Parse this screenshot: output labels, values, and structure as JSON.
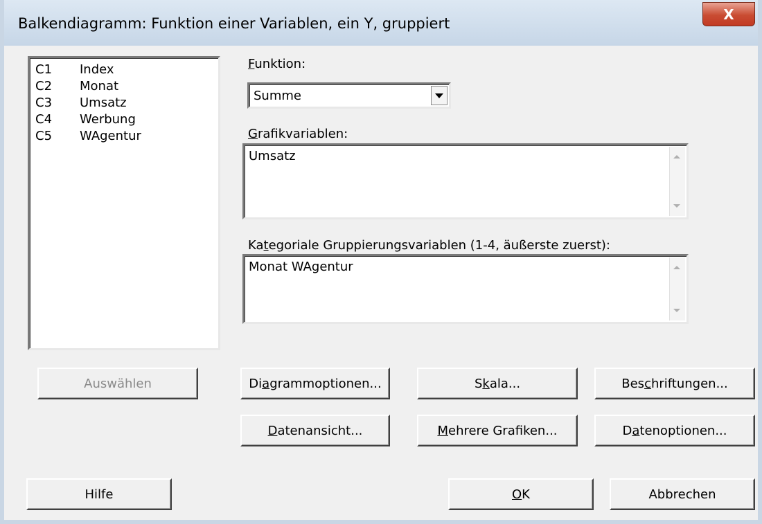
{
  "window": {
    "title": "Balkendiagramm: Funktion einer Variablen, ein Y, gruppiert",
    "close_label": "X"
  },
  "variables": [
    {
      "col": "C1",
      "name": "Index"
    },
    {
      "col": "C2",
      "name": "Monat"
    },
    {
      "col": "C3",
      "name": "Umsatz"
    },
    {
      "col": "C4",
      "name": "Werbung"
    },
    {
      "col": "C5",
      "name": "WAgentur"
    }
  ],
  "funktion": {
    "label_accel": "F",
    "label_rest": "unktion:",
    "value": "Summe"
  },
  "grafikvariablen": {
    "label_accel": "G",
    "label_rest": "rafikvariablen:",
    "value": "Umsatz"
  },
  "gruppierung": {
    "label_pre": "Ka",
    "label_accel": "t",
    "label_rest": "egoriale Gruppierungsvariablen (1-4, äußerste zuerst):",
    "value": "Monat WAgentur"
  },
  "buttons": {
    "auswaehlen": "Auswählen",
    "diagrammoptionen": {
      "pre": "Di",
      "accel": "a",
      "rest": "grammoptionen..."
    },
    "skala": {
      "pre": "S",
      "accel": "k",
      "rest": "ala..."
    },
    "beschriftungen": {
      "pre": "Bes",
      "accel": "c",
      "rest": "hriftungen..."
    },
    "datenansicht": {
      "pre": "",
      "accel": "D",
      "rest": "atenansicht..."
    },
    "mehrere_grafiken": {
      "pre": "",
      "accel": "M",
      "rest": "ehrere Grafiken..."
    },
    "datenoptionen": {
      "pre": "D",
      "accel": "a",
      "rest": "tenoptionen..."
    },
    "hilfe": "Hilfe",
    "ok": {
      "pre": "",
      "accel": "O",
      "rest": "K"
    },
    "abbrechen": "Abbrechen"
  },
  "colors": {
    "face": "#f0f0f0",
    "titlebar": "#c6d6e7",
    "close": "#c94c32",
    "disabled_text": "#8a8a8a"
  }
}
